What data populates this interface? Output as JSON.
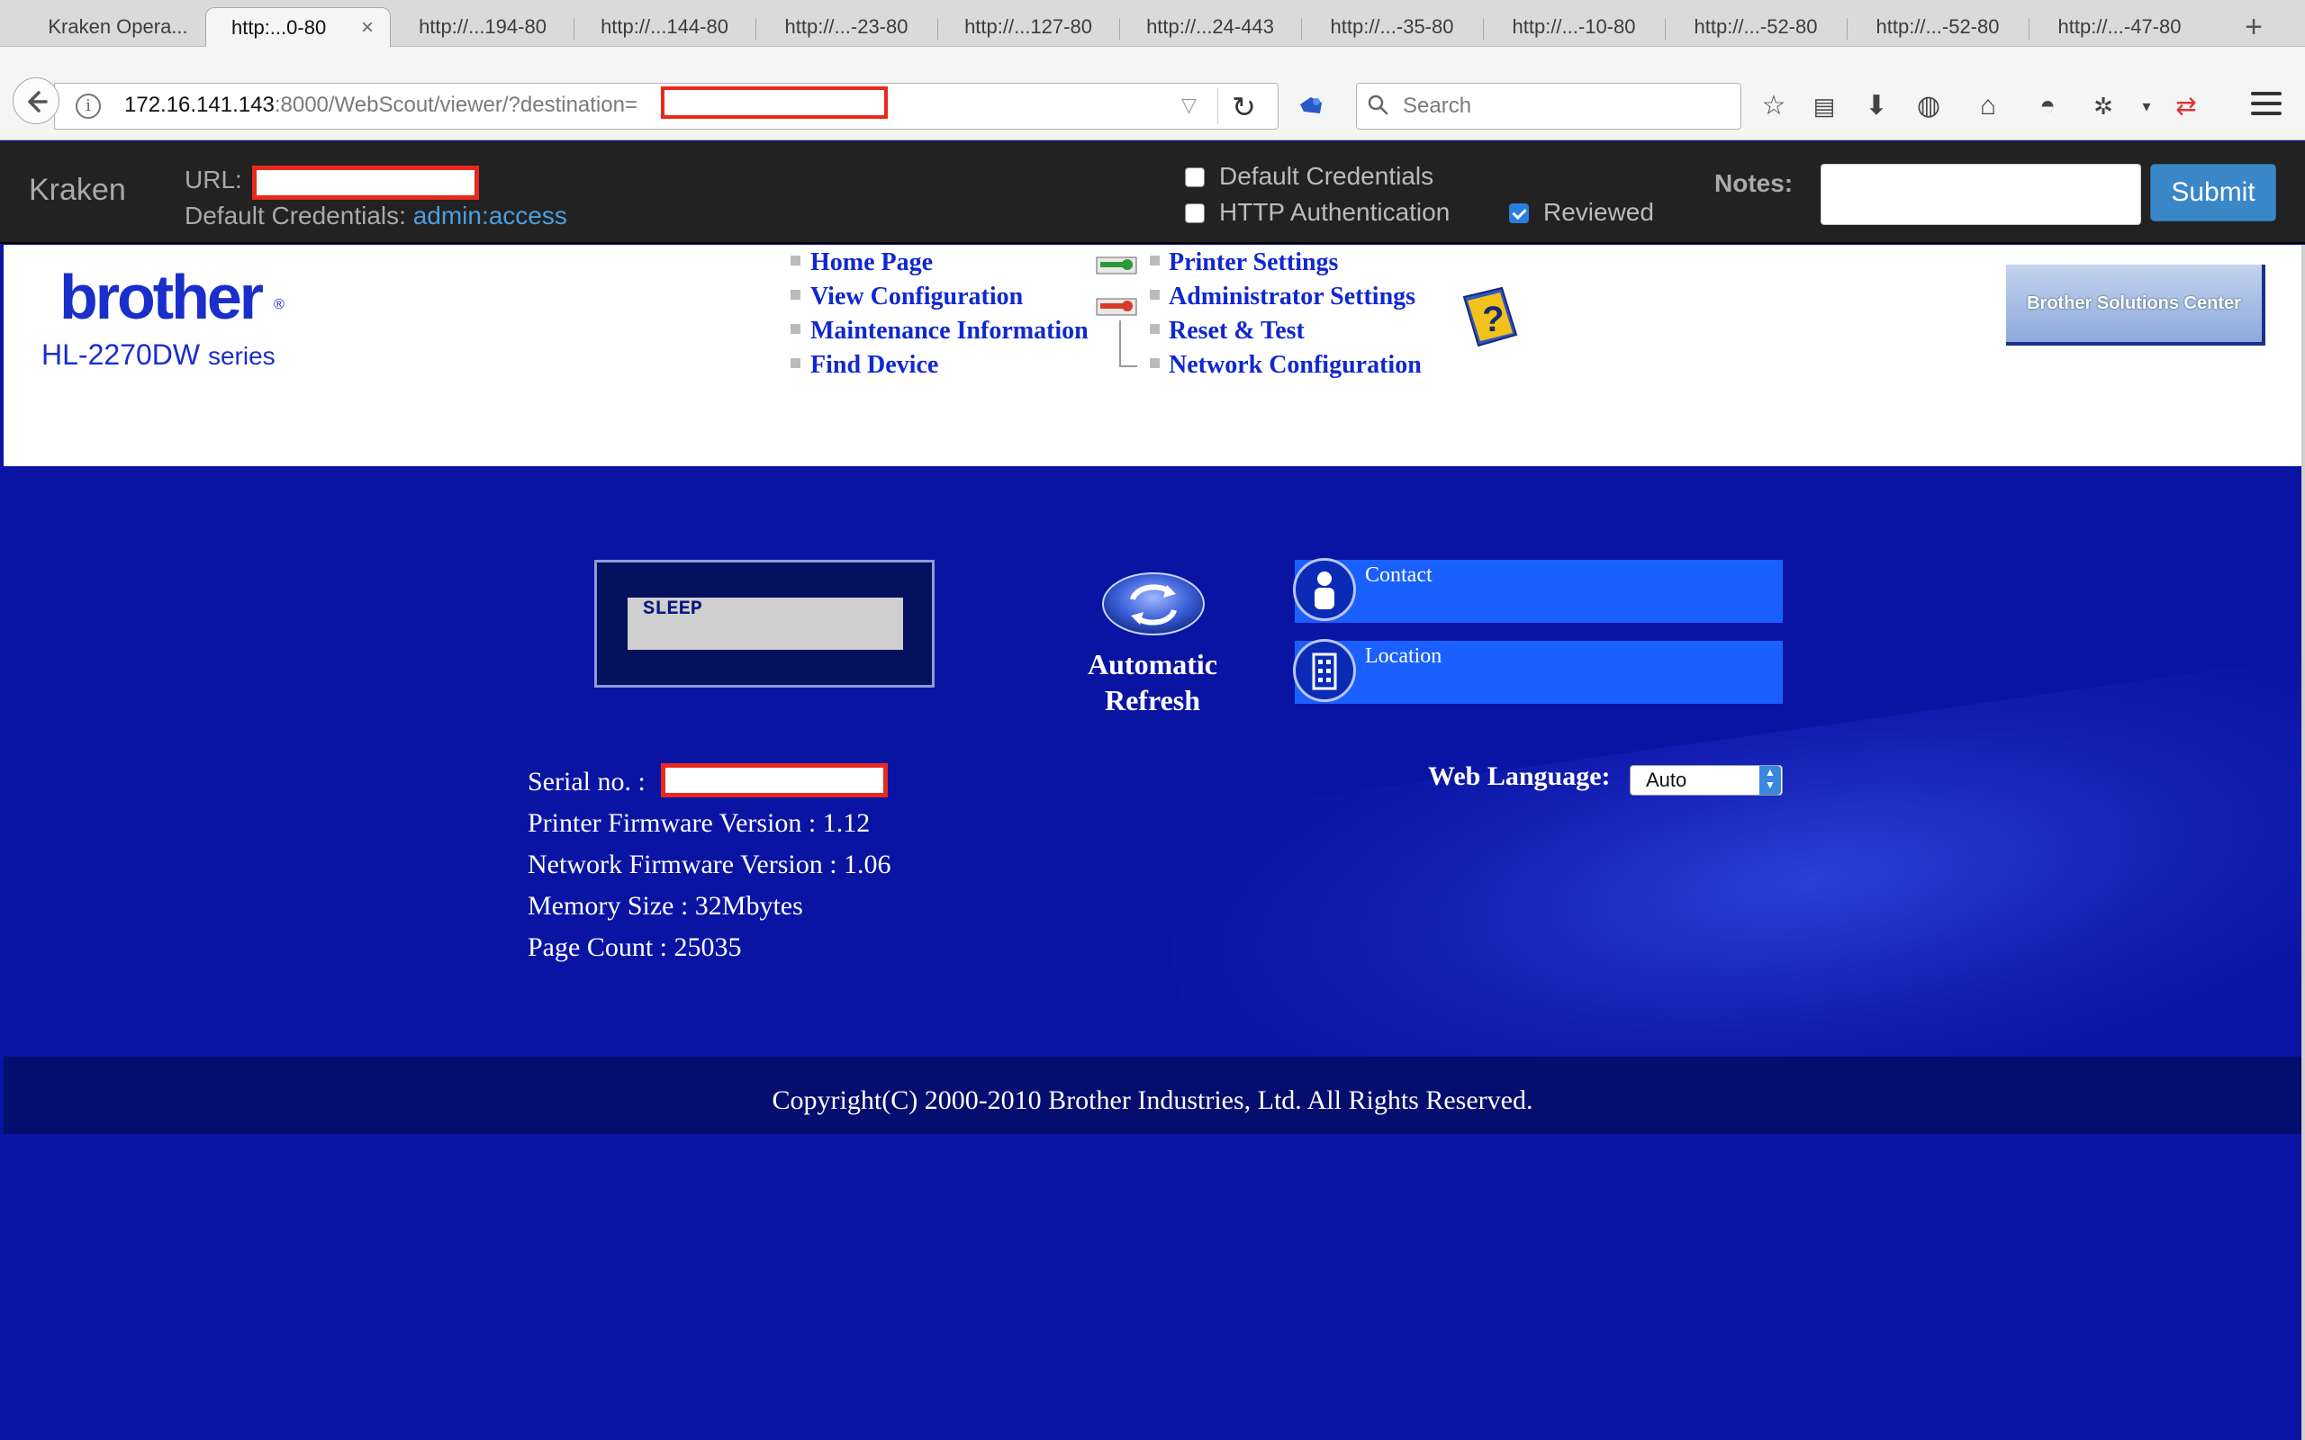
{
  "browser": {
    "tabs": [
      {
        "label": "Kraken Opera..."
      },
      {
        "label": "http:...0-80",
        "active": true
      },
      {
        "label": "http://...194-80"
      },
      {
        "label": "http://...144-80"
      },
      {
        "label": "http://...-23-80"
      },
      {
        "label": "http://...127-80"
      },
      {
        "label": "http://...24-443"
      },
      {
        "label": "http://...-35-80"
      },
      {
        "label": "http://...-10-80"
      },
      {
        "label": "http://...-52-80"
      },
      {
        "label": "http://...-52-80"
      },
      {
        "label": "http://...-47-80"
      }
    ],
    "new_tab": "+",
    "tab_close": "×",
    "url": {
      "host": "172.16.141.143",
      "rest": ":8000/WebScout/viewer/?destination="
    },
    "search_placeholder": "Search"
  },
  "kraken": {
    "title": "Kraken",
    "url_label": "URL:",
    "default_creds_label": "Default Credentials:",
    "default_creds_value": "admin:access",
    "checkbox_default_creds": {
      "label": "Default Credentials",
      "checked": false
    },
    "checkbox_http_auth": {
      "label": "HTTP Authentication",
      "checked": false
    },
    "checkbox_reviewed": {
      "label": "Reviewed",
      "checked": true
    },
    "notes_label": "Notes:",
    "submit_label": "Submit"
  },
  "printer": {
    "brand": "brother",
    "model": "HL-2270DW",
    "series": "series",
    "nav_left": [
      "Home Page",
      "View Configuration",
      "Maintenance Information",
      "Find Device"
    ],
    "nav_right": [
      "Printer Settings",
      "Administrator Settings",
      "Reset & Test",
      "Network Configuration"
    ],
    "solutions_center": "Brother Solutions Center",
    "status": "SLEEP",
    "refresh_line1": "Automatic",
    "refresh_line2": "Refresh",
    "contact_label": "Contact",
    "location_label": "Location",
    "serial_label": "Serial no. :",
    "printer_fw": "Printer Firmware Version : 1.12",
    "network_fw": "Network Firmware Version : 1.06",
    "memory": "Memory Size : 32Mbytes",
    "page_count": "Page Count : 25035",
    "web_language_label": "Web Language:",
    "web_language_value": "Auto",
    "copyright": "Copyright(C) 2000-2010 Brother Industries, Ltd. All Rights Reserved."
  },
  "colors": {
    "brand_blue": "#1a2ecb",
    "page_blue": "#0a14a3",
    "redaction": "#e8291c",
    "submit": "#3a87c8"
  }
}
